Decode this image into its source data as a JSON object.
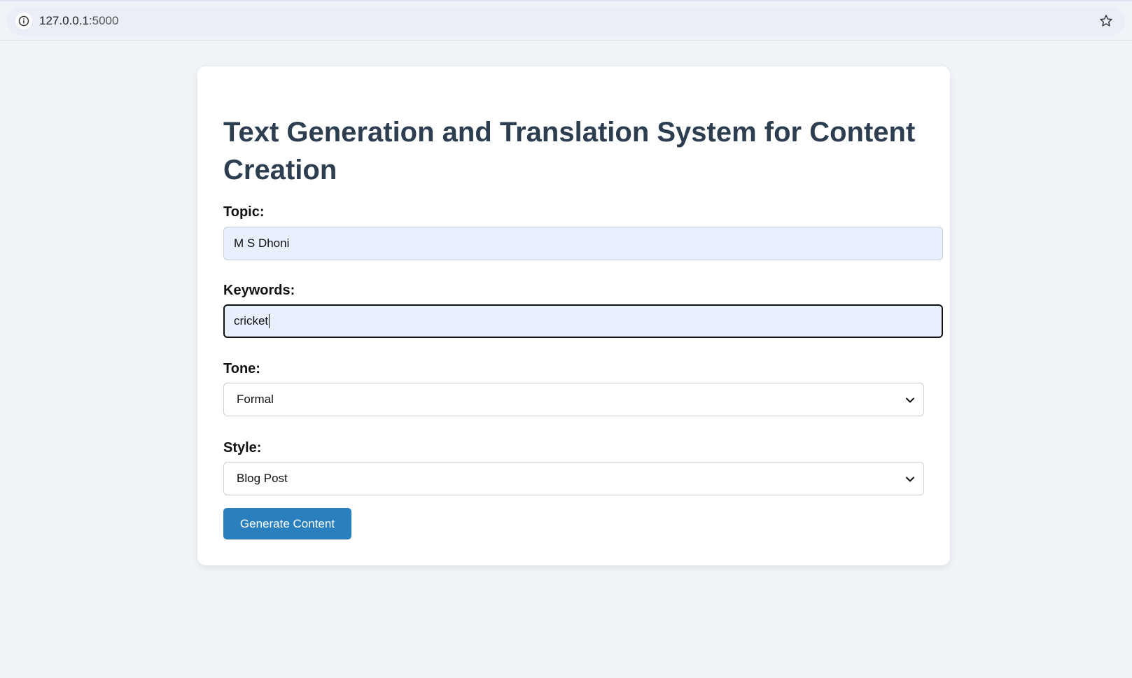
{
  "browser": {
    "url_host": "127.0.0.1",
    "url_port": ":5000",
    "info_icon": "info-icon",
    "bookmark_icon": "star-icon"
  },
  "form": {
    "title": "Text Generation and Translation System for Content Creation",
    "topic": {
      "label": "Topic:",
      "value": "M S Dhoni"
    },
    "keywords": {
      "label": "Keywords:",
      "value": "cricket"
    },
    "tone": {
      "label": "Tone:",
      "selected": "Formal"
    },
    "style": {
      "label": "Style:",
      "selected": "Blog Post"
    },
    "submit_label": "Generate Content"
  },
  "colors": {
    "title": "#2c3e50",
    "button": "#2a80bf",
    "input_bg": "#e8effd",
    "page_bg": "#f0f3f8"
  }
}
